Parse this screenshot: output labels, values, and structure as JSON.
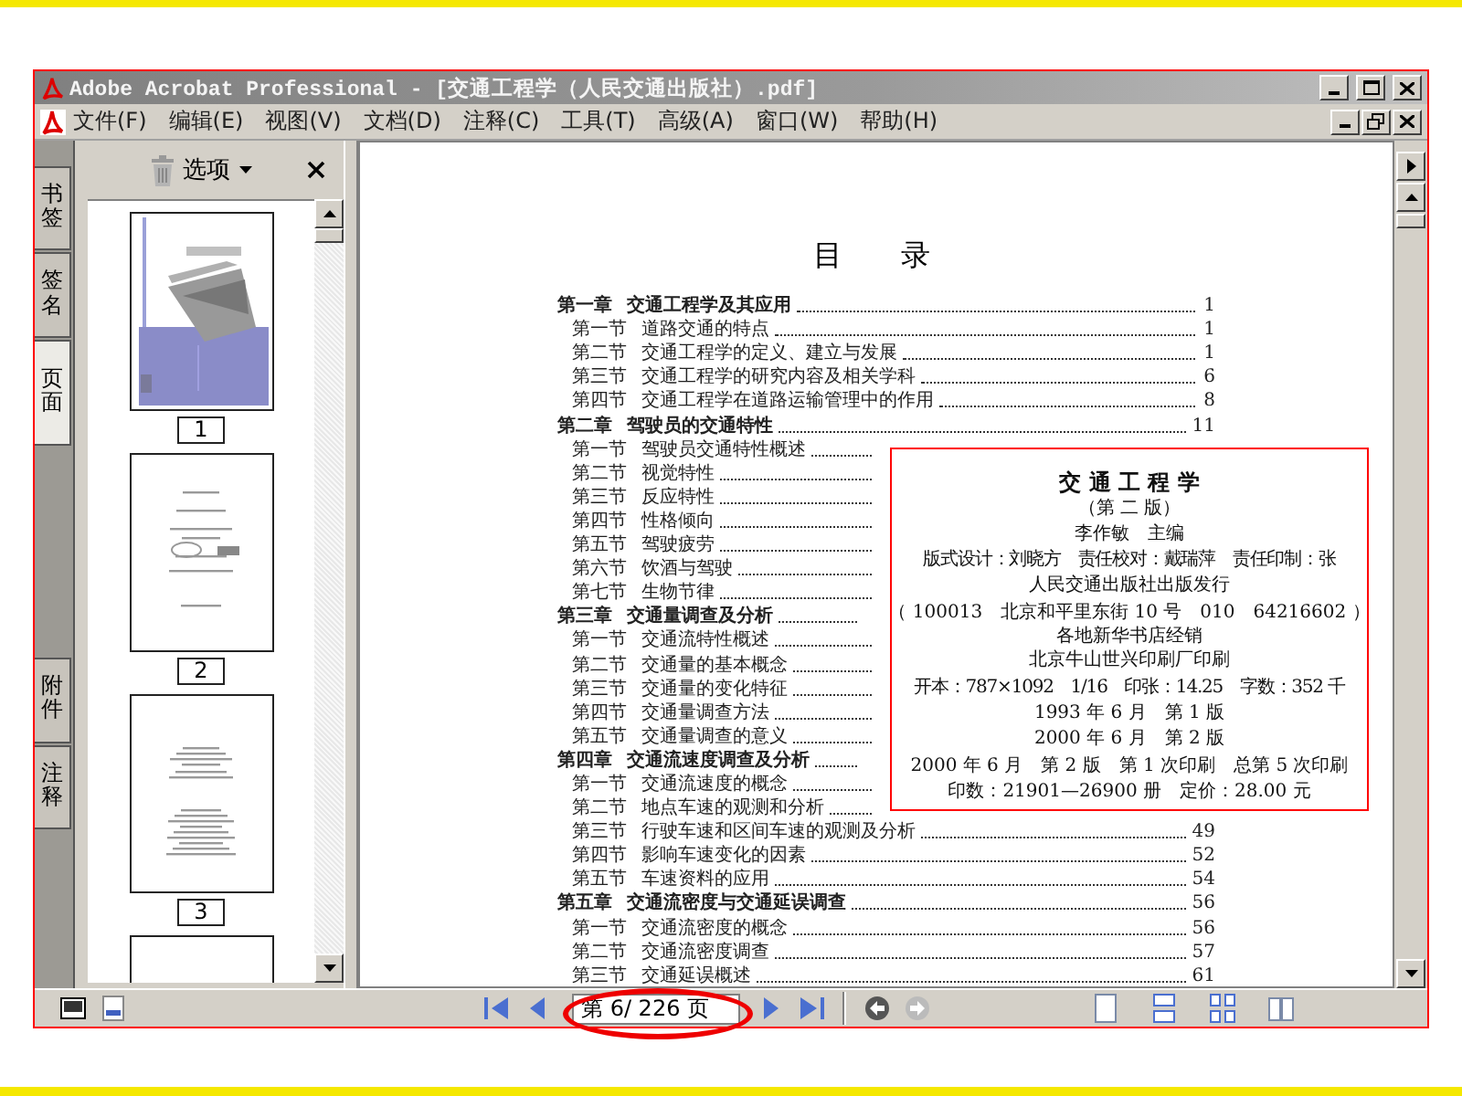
{
  "window": {
    "title": "Adobe Acrobat Professional - [交通工程学（人民交通出版社）.pdf]"
  },
  "menu": [
    "文件(F)",
    "编辑(E)",
    "视图(V)",
    "文档(D)",
    "注释(C)",
    "工具(T)",
    "高级(A)",
    "窗口(W)",
    "帮助(H)"
  ],
  "side_tabs": [
    {
      "label": "书签",
      "selected": false
    },
    {
      "label": "签名",
      "selected": false
    },
    {
      "label": "页面",
      "selected": true
    },
    {
      "label": "附件",
      "selected": false
    },
    {
      "label": "注释",
      "selected": false
    }
  ],
  "panel": {
    "options": "选项"
  },
  "thumbnails": [
    {
      "kind": "picture",
      "label": "1"
    },
    {
      "kind": "page",
      "label": "2"
    },
    {
      "kind": "page",
      "label": "3"
    },
    {
      "kind": "page"
    }
  ],
  "document": {
    "heading": "目　　录",
    "toc": [
      {
        "kind": "chapter",
        "number": "第一章",
        "title": "交通工程学及其应用",
        "page": "1"
      },
      {
        "kind": "section",
        "number": "第一节",
        "title": "道路交通的特点",
        "page": "1"
      },
      {
        "kind": "section",
        "number": "第二节",
        "title": "交通工程学的定义、建立与发展",
        "page": "1"
      },
      {
        "kind": "section",
        "number": "第三节",
        "title": "交通工程学的研究内容及相关学科",
        "page": "6"
      },
      {
        "kind": "section",
        "number": "第四节",
        "title": "交通工程学在道路运输管理中的作用",
        "page": "8"
      },
      {
        "kind": "chapter",
        "number": "第二章",
        "title": "驾驶员的交通特性",
        "page": "11"
      },
      {
        "kind": "section",
        "number": "第一节",
        "title": "驾驶员交通特性概述"
      },
      {
        "kind": "section",
        "number": "第二节",
        "title": "视觉特性"
      },
      {
        "kind": "section",
        "number": "第三节",
        "title": "反应特性"
      },
      {
        "kind": "section",
        "number": "第四节",
        "title": "性格倾向"
      },
      {
        "kind": "section",
        "number": "第五节",
        "title": "驾驶疲劳"
      },
      {
        "kind": "section",
        "number": "第六节",
        "title": "饮酒与驾驶"
      },
      {
        "kind": "section",
        "number": "第七节",
        "title": "生物节律"
      },
      {
        "kind": "chapter",
        "number": "第三章",
        "title": "交通量调查及分析"
      },
      {
        "kind": "section",
        "number": "第一节",
        "title": "交通流特性概述"
      },
      {
        "kind": "section",
        "number": "第二节",
        "title": "交通量的基本概念"
      },
      {
        "kind": "section",
        "number": "第三节",
        "title": "交通量的变化特征"
      },
      {
        "kind": "section",
        "number": "第四节",
        "title": "交通量调查方法"
      },
      {
        "kind": "section",
        "number": "第五节",
        "title": "交通量调查的意义"
      },
      {
        "kind": "chapter",
        "number": "第四章",
        "title": "交通流速度调查及分析"
      },
      {
        "kind": "section",
        "number": "第一节",
        "title": "交通流速度的概念"
      },
      {
        "kind": "section",
        "number": "第二节",
        "title": "地点车速的观测和分析"
      },
      {
        "kind": "section",
        "number": "第三节",
        "title": "行驶车速和区间车速的观测及分析",
        "page": "49"
      },
      {
        "kind": "section",
        "number": "第四节",
        "title": "影响车速变化的因素",
        "page": "52"
      },
      {
        "kind": "section",
        "number": "第五节",
        "title": "车速资料的应用",
        "page": "54"
      },
      {
        "kind": "chapter",
        "number": "第五章",
        "title": "交通流密度与交通延误调查",
        "page": "56"
      },
      {
        "kind": "section",
        "number": "第一节",
        "title": "交通流密度的概念",
        "page": "56"
      },
      {
        "kind": "section",
        "number": "第二节",
        "title": "交通流密度调查",
        "page": "57"
      },
      {
        "kind": "section",
        "number": "第三节",
        "title": "交通延误概述",
        "page": "61"
      }
    ]
  },
  "inset": [
    {
      "kind": "title",
      "text": "交 通 工 程 学"
    },
    {
      "kind": "line",
      "text": "（第 二 版）"
    },
    {
      "kind": "line",
      "text": "李作敏　主编"
    },
    {
      "kind": "compact",
      "text": "版式设计：刘晓方　责任校对：戴瑞萍　责任印制：张"
    },
    {
      "kind": "small",
      "text": "人民交通出版社出版发行"
    },
    {
      "kind": "small",
      "text": "（ 100013　北京和平里东街 10 号　010　64216602 ）"
    },
    {
      "kind": "tight",
      "text": "各地新华书店经销"
    },
    {
      "kind": "small",
      "text": "北京牛山世兴印刷厂印刷"
    },
    {
      "kind": "compact",
      "text": "开本：787×1092　1/16　印张：14.25　字数：352 千"
    },
    {
      "kind": "small",
      "text": "1993 年 6 月　第 1 版"
    },
    {
      "kind": "small",
      "text": "2000 年 6 月　第 2 版"
    },
    {
      "kind": "small",
      "text": "2000 年 6 月　第 2 版　第 1 次印刷　总第 5 次印刷"
    },
    {
      "kind": "small",
      "text": "印数：21901—26900 册　定价：28.00 元"
    }
  ],
  "page_nav": {
    "current": "第 6/ 226 页"
  }
}
